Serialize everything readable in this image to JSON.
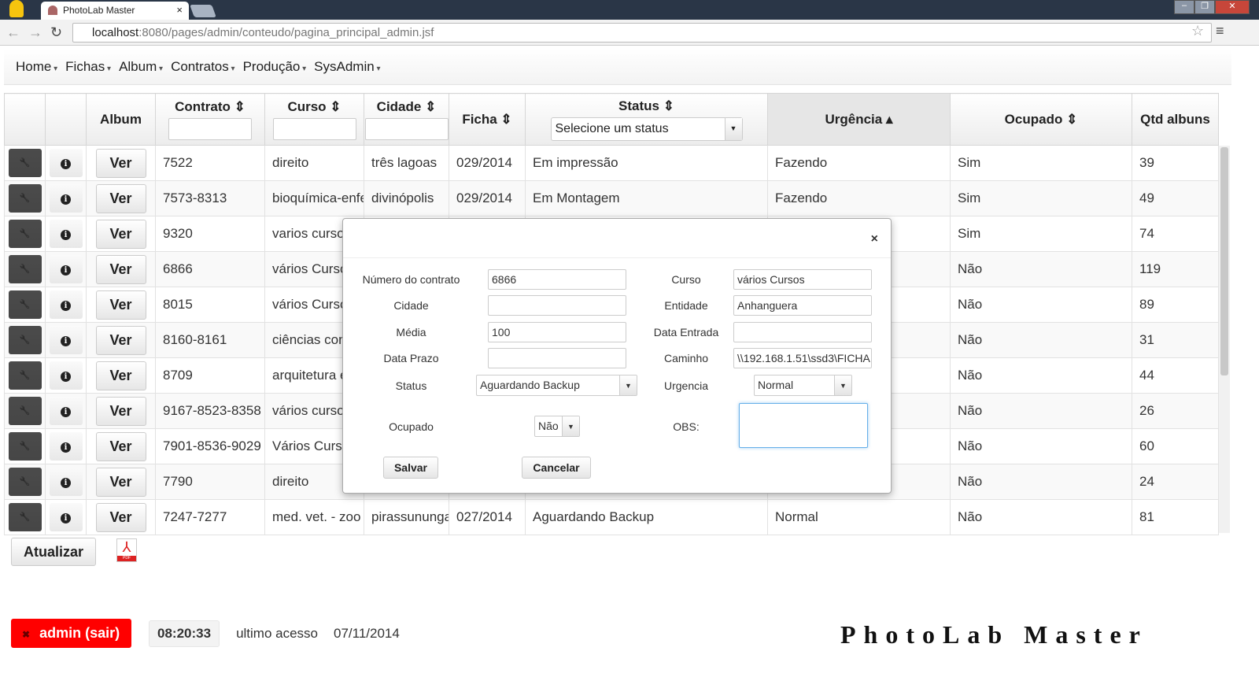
{
  "browser": {
    "tab_title": "PhotoLab Master",
    "url_host": "localhost",
    "url_rest": ":8080/pages/admin/conteudo/pagina_principal_admin.jsf"
  },
  "menu": [
    "Home",
    "Fichas",
    "Album",
    "Contratos",
    "Produção",
    "SysAdmin"
  ],
  "table": {
    "headers": {
      "album": "Album",
      "contrato": "Contrato ⇕",
      "curso": "Curso ⇕",
      "cidade": "Cidade ⇕",
      "ficha": "Ficha ⇕",
      "status": "Status ⇕",
      "urgencia": "Urgência ▴",
      "ocupado": "Ocupado ⇕",
      "qtd": "Qtd albuns"
    },
    "status_filter": "Selecione um status",
    "ver_label": "Ver",
    "rows": [
      [
        "7522",
        "direito",
        "três lagoas",
        "029/2014",
        "Em impressão",
        "Fazendo",
        "Sim",
        "39"
      ],
      [
        "7573-8313",
        "bioquímica-enfe",
        "divinópolis",
        "029/2014",
        "Em Montagem",
        "Fazendo",
        "Sim",
        "49"
      ],
      [
        "9320",
        "varios cursos",
        "",
        "",
        "",
        "",
        "Sim",
        "74"
      ],
      [
        "6866",
        "vários Cursos",
        "",
        "",
        "",
        "",
        "Não",
        "119"
      ],
      [
        "8015",
        "vários Cursos",
        "",
        "",
        "",
        "",
        "Não",
        "89"
      ],
      [
        "8160-8161",
        "ciências cont",
        "",
        "",
        "",
        "",
        "Não",
        "31"
      ],
      [
        "8709",
        "arquitetura e",
        "",
        "",
        "",
        "",
        "Não",
        "44"
      ],
      [
        "9167-8523-8358",
        "vários cursos",
        "",
        "",
        "",
        "",
        "Não",
        "26"
      ],
      [
        "7901-8536-9029",
        "Vários Cursos",
        "",
        "",
        "",
        "",
        "Não",
        "60"
      ],
      [
        "7790",
        "direito",
        "",
        "",
        "",
        "",
        "Não",
        "24"
      ],
      [
        "7247-7277",
        "med. vet. - zoo",
        "pirassununga",
        "027/2014",
        "Aguardando Backup",
        "Normal",
        "Não",
        "81"
      ]
    ]
  },
  "actions": {
    "refresh": "Atualizar"
  },
  "modal": {
    "close": "×",
    "labels": {
      "numero": "Número do contrato",
      "cidade": "Cidade",
      "media": "Média",
      "prazo": "Data Prazo",
      "status": "Status",
      "ocupado": "Ocupado",
      "curso": "Curso",
      "entidade": "Entidade",
      "entrada": "Data Entrada",
      "caminho": "Caminho",
      "urgencia": "Urgencia",
      "obs": "OBS:"
    },
    "values": {
      "numero": "6866",
      "cidade": "",
      "media": "100",
      "prazo": "",
      "status": "Aguardando Backup",
      "ocupado": "Não",
      "curso": "vários Cursos",
      "entidade": "Anhanguera",
      "entrada": "",
      "caminho": "\\\\192.168.1.51\\ssd3\\FICHA",
      "urgencia": "Normal",
      "obs": ""
    },
    "save": "Salvar",
    "cancel": "Cancelar"
  },
  "footer": {
    "user": "admin (sair)",
    "time": "08:20:33",
    "last_access_label": "ultimo acesso",
    "last_access": "07/11/2014",
    "brand": "PhotoLab Master"
  },
  "colors": {
    "logout": "#ff0000",
    "tabbar": "#2a3647"
  }
}
